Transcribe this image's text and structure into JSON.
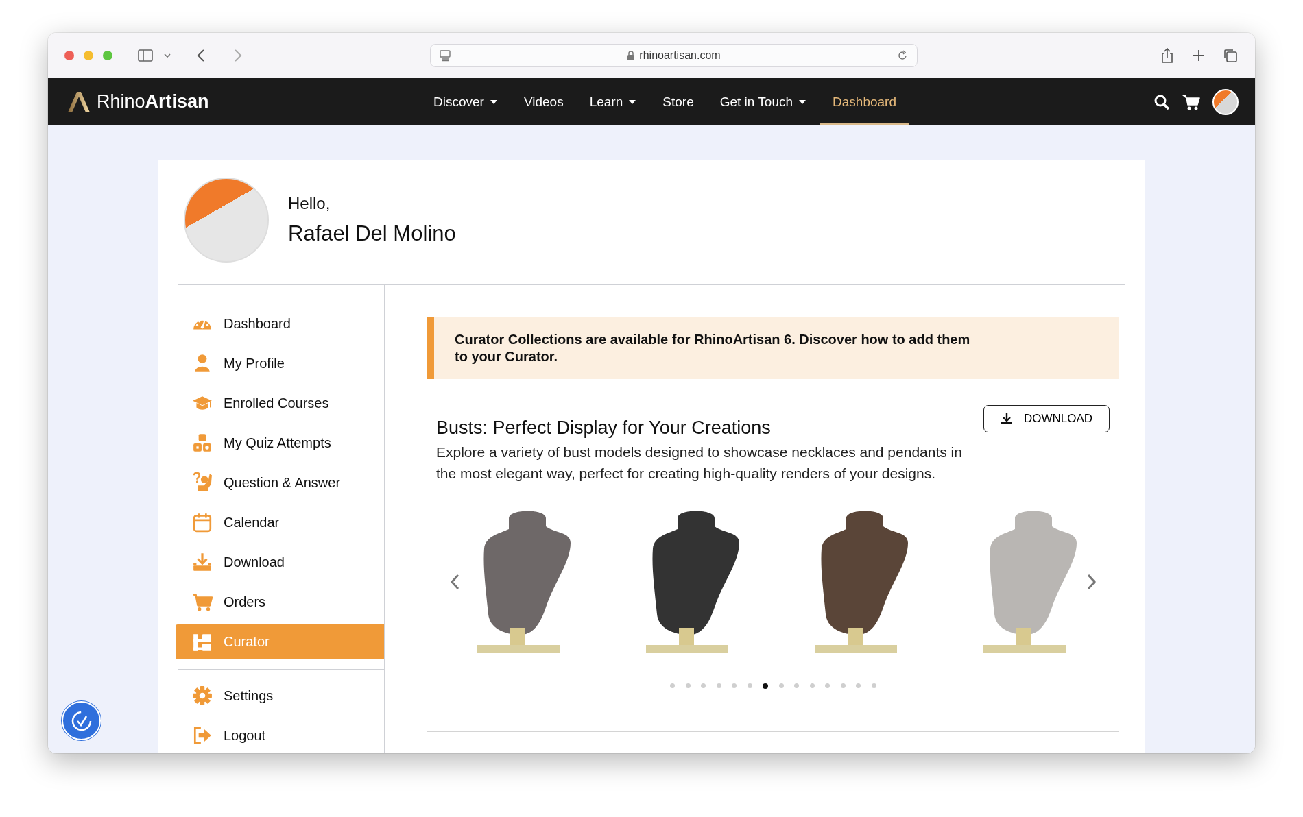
{
  "browser": {
    "url": "rhinoartisan.com"
  },
  "navbar": {
    "logo": "Rhino**Artisan**",
    "items": [
      {
        "label": "Discover",
        "dropdown": true,
        "selected": false
      },
      {
        "label": "Videos",
        "dropdown": false,
        "selected": false
      },
      {
        "label": "Learn",
        "dropdown": true,
        "selected": false
      },
      {
        "label": "Store",
        "dropdown": false,
        "selected": false
      },
      {
        "label": "Get in Touch",
        "dropdown": true,
        "selected": false
      },
      {
        "label": "Dashboard",
        "dropdown": false,
        "selected": true
      }
    ]
  },
  "profile": {
    "greeting": "Hello,",
    "name": "Rafael Del Molino"
  },
  "sidebar": {
    "items": [
      {
        "label": "Dashboard",
        "selected": false
      },
      {
        "label": "My Profile",
        "selected": false
      },
      {
        "label": "Enrolled Courses",
        "selected": false
      },
      {
        "label": "My Quiz Attempts",
        "selected": false
      },
      {
        "label": "Question & Answer",
        "selected": false
      },
      {
        "label": "Calendar",
        "selected": false
      },
      {
        "label": "Download",
        "selected": false
      },
      {
        "label": "Orders",
        "selected": false
      },
      {
        "label": "Curator",
        "selected": true
      }
    ],
    "footer_items": [
      {
        "label": "Settings",
        "selected": false
      },
      {
        "label": "Logout",
        "selected": false
      }
    ]
  },
  "notice": {
    "text": "Curator Collections are available for RhinoArtisan 6. Discover how to add them to your Curator."
  },
  "collection": {
    "title": "Busts: Perfect Display for Your Creations",
    "description": "Explore a variety of bust models designed to showcase necklaces and pendants in the most elegant way, perfect for creating high-quality renders of your designs.",
    "download_button": "DOWNLOAD",
    "busts": [
      {
        "color": "#6e6868"
      },
      {
        "color": "#333333"
      },
      {
        "color": "#5a4538"
      },
      {
        "color": "#b9b6b3"
      }
    ],
    "dots": [
      {
        "selected": false
      },
      {
        "selected": false
      },
      {
        "selected": false
      },
      {
        "selected": false
      },
      {
        "selected": false
      },
      {
        "selected": false
      },
      {
        "selected": true
      },
      {
        "selected": false
      },
      {
        "selected": false
      },
      {
        "selected": false
      },
      {
        "selected": false
      },
      {
        "selected": false
      },
      {
        "selected": false
      },
      {
        "selected": false
      }
    ]
  }
}
